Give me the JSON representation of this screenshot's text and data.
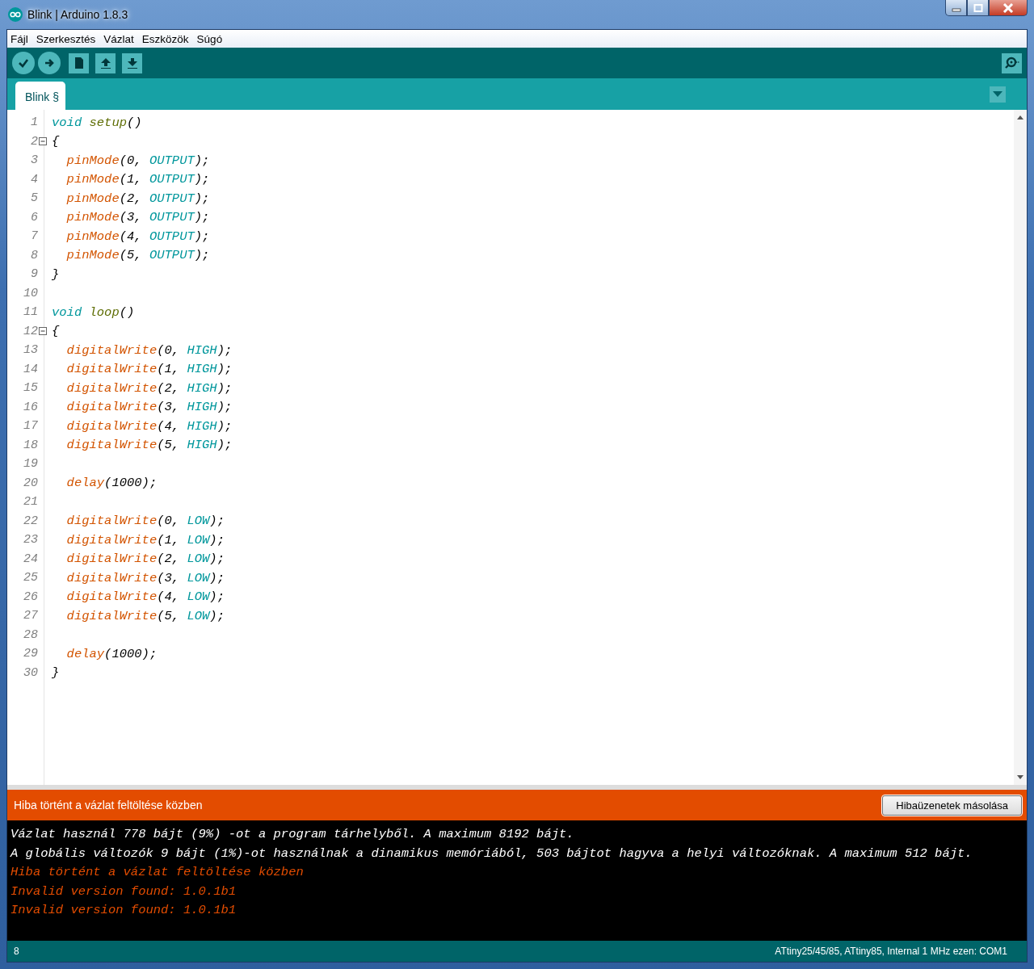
{
  "window": {
    "title": "Blink | Arduino 1.8.3"
  },
  "menu": [
    {
      "label": "Fájl"
    },
    {
      "label": "Szerkesztés"
    },
    {
      "label": "Vázlat"
    },
    {
      "label": "Eszközök"
    },
    {
      "label": "Súgó"
    }
  ],
  "tabs": [
    {
      "label": "Blink §",
      "selected": true
    }
  ],
  "editor": {
    "lines": [
      {
        "number": "1",
        "foldable": false,
        "indented": false,
        "tokens": [
          {
            "kind": "type",
            "text": "void"
          },
          {
            "kind": "func",
            "text": "setup"
          },
          {
            "kind": "plain",
            "text": "()"
          }
        ]
      },
      {
        "number": "2",
        "foldable": true,
        "indented": false,
        "tokens": [
          {
            "kind": "plain",
            "text": "{"
          }
        ]
      },
      {
        "number": "3",
        "foldable": false,
        "indented": true,
        "tokens": [
          {
            "kind": "builtin",
            "text": "pinMode"
          },
          {
            "kind": "plain",
            "text": "(0, "
          },
          {
            "kind": "const",
            "text": "OUTPUT"
          },
          {
            "kind": "plain",
            "text": ");"
          }
        ]
      },
      {
        "number": "4",
        "foldable": false,
        "indented": true,
        "tokens": [
          {
            "kind": "builtin",
            "text": "pinMode"
          },
          {
            "kind": "plain",
            "text": "(1, "
          },
          {
            "kind": "const",
            "text": "OUTPUT"
          },
          {
            "kind": "plain",
            "text": ");"
          }
        ]
      },
      {
        "number": "5",
        "foldable": false,
        "indented": true,
        "tokens": [
          {
            "kind": "builtin",
            "text": "pinMode"
          },
          {
            "kind": "plain",
            "text": "(2, "
          },
          {
            "kind": "const",
            "text": "OUTPUT"
          },
          {
            "kind": "plain",
            "text": ");"
          }
        ]
      },
      {
        "number": "6",
        "foldable": false,
        "indented": true,
        "tokens": [
          {
            "kind": "builtin",
            "text": "pinMode"
          },
          {
            "kind": "plain",
            "text": "(3, "
          },
          {
            "kind": "const",
            "text": "OUTPUT"
          },
          {
            "kind": "plain",
            "text": ");"
          }
        ]
      },
      {
        "number": "7",
        "foldable": false,
        "indented": true,
        "tokens": [
          {
            "kind": "builtin",
            "text": "pinMode"
          },
          {
            "kind": "plain",
            "text": "(4, "
          },
          {
            "kind": "const",
            "text": "OUTPUT"
          },
          {
            "kind": "plain",
            "text": ");"
          }
        ]
      },
      {
        "number": "8",
        "foldable": false,
        "indented": true,
        "tokens": [
          {
            "kind": "builtin",
            "text": "pinMode"
          },
          {
            "kind": "plain",
            "text": "(5, "
          },
          {
            "kind": "const",
            "text": "OUTPUT"
          },
          {
            "kind": "plain",
            "text": ");"
          }
        ]
      },
      {
        "number": "9",
        "foldable": false,
        "indented": false,
        "tokens": [
          {
            "kind": "plain",
            "text": "}"
          }
        ]
      },
      {
        "number": "10",
        "foldable": false
      },
      {
        "number": "11",
        "foldable": false,
        "indented": false,
        "tokens": [
          {
            "kind": "type",
            "text": "void"
          },
          {
            "kind": "func",
            "text": "loop"
          },
          {
            "kind": "plain",
            "text": "()"
          }
        ]
      },
      {
        "number": "12",
        "foldable": true,
        "indented": false,
        "tokens": [
          {
            "kind": "plain",
            "text": "{"
          }
        ]
      },
      {
        "number": "13",
        "foldable": false,
        "indented": true,
        "tokens": [
          {
            "kind": "builtin",
            "text": "digitalWrite"
          },
          {
            "kind": "plain",
            "text": "(0, "
          },
          {
            "kind": "const",
            "text": "HIGH"
          },
          {
            "kind": "plain",
            "text": ");"
          }
        ]
      },
      {
        "number": "14",
        "foldable": false,
        "indented": true,
        "tokens": [
          {
            "kind": "builtin",
            "text": "digitalWrite"
          },
          {
            "kind": "plain",
            "text": "(1, "
          },
          {
            "kind": "const",
            "text": "HIGH"
          },
          {
            "kind": "plain",
            "text": ");"
          }
        ]
      },
      {
        "number": "15",
        "foldable": false,
        "indented": true,
        "tokens": [
          {
            "kind": "builtin",
            "text": "digitalWrite"
          },
          {
            "kind": "plain",
            "text": "(2, "
          },
          {
            "kind": "const",
            "text": "HIGH"
          },
          {
            "kind": "plain",
            "text": ");"
          }
        ]
      },
      {
        "number": "16",
        "foldable": false,
        "indented": true,
        "tokens": [
          {
            "kind": "builtin",
            "text": "digitalWrite"
          },
          {
            "kind": "plain",
            "text": "(3, "
          },
          {
            "kind": "const",
            "text": "HIGH"
          },
          {
            "kind": "plain",
            "text": ");"
          }
        ]
      },
      {
        "number": "17",
        "foldable": false,
        "indented": true,
        "tokens": [
          {
            "kind": "builtin",
            "text": "digitalWrite"
          },
          {
            "kind": "plain",
            "text": "(4, "
          },
          {
            "kind": "const",
            "text": "HIGH"
          },
          {
            "kind": "plain",
            "text": ");"
          }
        ]
      },
      {
        "number": "18",
        "foldable": false,
        "indented": true,
        "tokens": [
          {
            "kind": "builtin",
            "text": "digitalWrite"
          },
          {
            "kind": "plain",
            "text": "(5, "
          },
          {
            "kind": "const",
            "text": "HIGH"
          },
          {
            "kind": "plain",
            "text": ");"
          }
        ]
      },
      {
        "number": "19",
        "foldable": false
      },
      {
        "number": "20",
        "foldable": false,
        "indented": true,
        "tokens": [
          {
            "kind": "builtin",
            "text": "delay"
          },
          {
            "kind": "plain",
            "text": "(1000);"
          }
        ]
      },
      {
        "number": "21",
        "foldable": false
      },
      {
        "number": "22",
        "foldable": false,
        "indented": true,
        "tokens": [
          {
            "kind": "builtin",
            "text": "digitalWrite"
          },
          {
            "kind": "plain",
            "text": "(0, "
          },
          {
            "kind": "const",
            "text": "LOW"
          },
          {
            "kind": "plain",
            "text": ");"
          }
        ]
      },
      {
        "number": "23",
        "foldable": false,
        "indented": true,
        "tokens": [
          {
            "kind": "builtin",
            "text": "digitalWrite"
          },
          {
            "kind": "plain",
            "text": "(1, "
          },
          {
            "kind": "const",
            "text": "LOW"
          },
          {
            "kind": "plain",
            "text": ");"
          }
        ]
      },
      {
        "number": "24",
        "foldable": false,
        "indented": true,
        "tokens": [
          {
            "kind": "builtin",
            "text": "digitalWrite"
          },
          {
            "kind": "plain",
            "text": "(2, "
          },
          {
            "kind": "const",
            "text": "LOW"
          },
          {
            "kind": "plain",
            "text": ");"
          }
        ]
      },
      {
        "number": "25",
        "foldable": false,
        "indented": true,
        "tokens": [
          {
            "kind": "builtin",
            "text": "digitalWrite"
          },
          {
            "kind": "plain",
            "text": "(3, "
          },
          {
            "kind": "const",
            "text": "LOW"
          },
          {
            "kind": "plain",
            "text": ");"
          }
        ]
      },
      {
        "number": "26",
        "foldable": false,
        "indented": true,
        "tokens": [
          {
            "kind": "builtin",
            "text": "digitalWrite"
          },
          {
            "kind": "plain",
            "text": "(4, "
          },
          {
            "kind": "const",
            "text": "LOW"
          },
          {
            "kind": "plain",
            "text": ");"
          }
        ]
      },
      {
        "number": "27",
        "foldable": false,
        "indented": true,
        "tokens": [
          {
            "kind": "builtin",
            "text": "digitalWrite"
          },
          {
            "kind": "plain",
            "text": "(5, "
          },
          {
            "kind": "const",
            "text": "LOW"
          },
          {
            "kind": "plain",
            "text": ");"
          }
        ]
      },
      {
        "number": "28",
        "foldable": false
      },
      {
        "number": "29",
        "foldable": false,
        "indented": true,
        "tokens": [
          {
            "kind": "builtin",
            "text": "delay"
          },
          {
            "kind": "plain",
            "text": "(1000);"
          }
        ]
      },
      {
        "number": "30",
        "foldable": false,
        "indented": false,
        "tokens": [
          {
            "kind": "plain",
            "text": "}"
          }
        ]
      }
    ]
  },
  "error_bar": {
    "message": "Hiba történt a vázlat feltöltése közben",
    "button": "Hibaüzenetek másolása"
  },
  "console": [
    {
      "kind": "info",
      "text": "Vázlat használ 778 bájt (9%) -ot a program tárhelyből. A maximum 8192 bájt."
    },
    {
      "kind": "info",
      "text": "A globális változók 9 bájt (1%)-ot használnak a dinamikus memóriából, 503 bájtot hagyva a helyi változóknak. A maximum 512 bájt."
    },
    {
      "kind": "error",
      "text": "Hiba történt a vázlat feltöltése közben"
    },
    {
      "kind": "error",
      "text": "Invalid version found: 1.0.1b1"
    },
    {
      "kind": "error",
      "text": "Invalid version found: 1.0.1b1"
    }
  ],
  "status_bar": {
    "line": "8",
    "board": "ATtiny25/45/85, ATtiny85, Internal 1 MHz ezen: COM1"
  }
}
